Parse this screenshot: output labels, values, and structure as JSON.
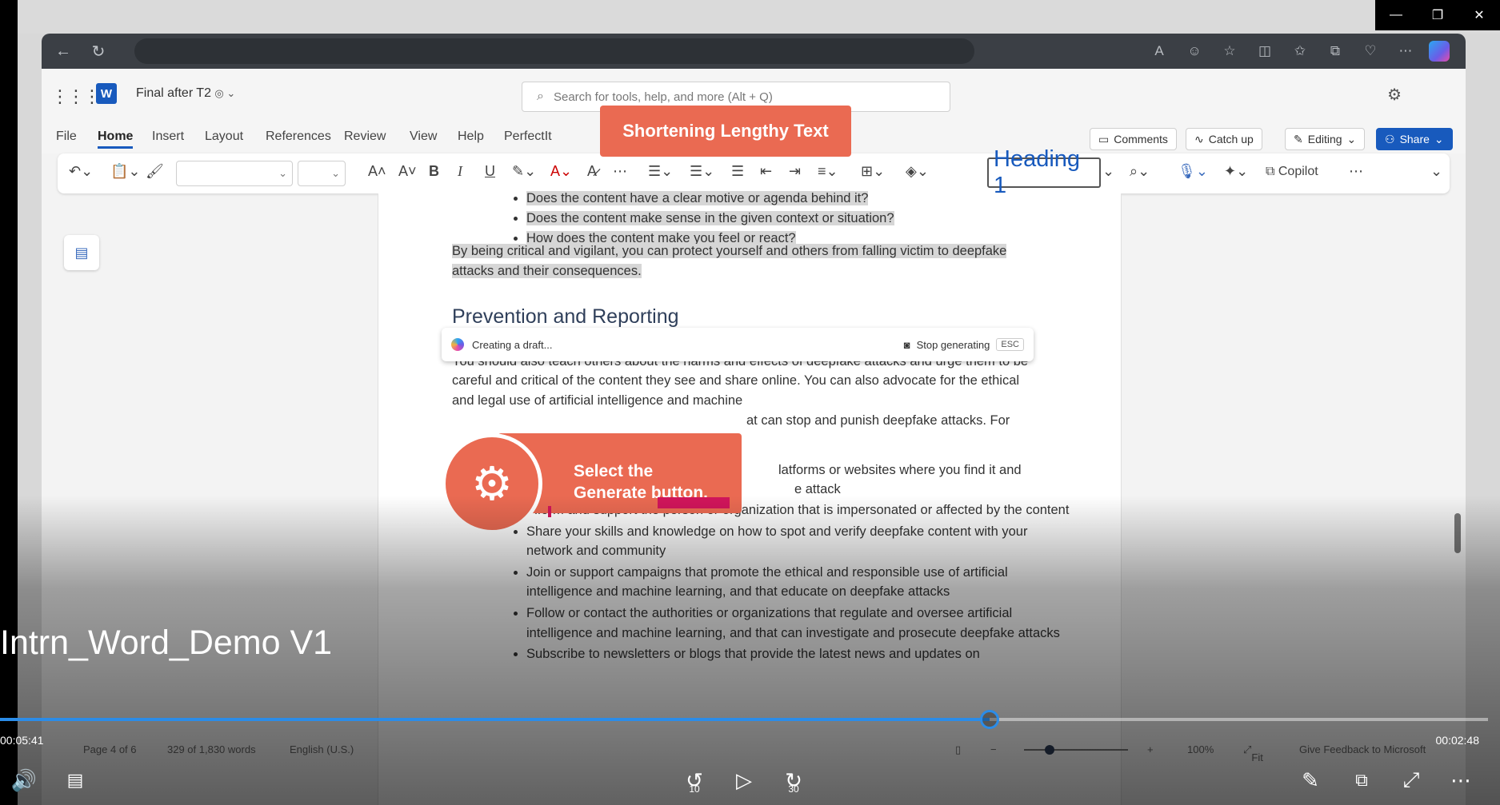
{
  "browser": {
    "icons": [
      "back-icon",
      "refresh-icon",
      "read-aloud-icon",
      "profile-icon",
      "favorite-star-icon",
      "split-screen-icon",
      "favorites-icon",
      "collections-icon",
      "browser-essentials-icon",
      "more-icon",
      "copilot-icon"
    ]
  },
  "word": {
    "app_letter": "W",
    "doc_title": "Final after T2",
    "search_placeholder": "Search for tools, help, and more (Alt + Q)",
    "tabs": [
      "File",
      "Home",
      "Insert",
      "Layout",
      "References",
      "Review",
      "View",
      "Help",
      "PerfectIt"
    ],
    "active_tab": "Home",
    "buttons": {
      "comments": "Comments",
      "catch_up": "Catch up",
      "editing": "Editing",
      "share": "Share"
    },
    "toolbar": {
      "style": "Heading 1",
      "copilot": "Copilot"
    }
  },
  "callouts": {
    "top": "Shortening Lengthy Text",
    "generate_line1": "Select the",
    "generate_line2": "Generate button."
  },
  "document": {
    "bullets_top": [
      "Does the content have a clear motive or agenda behind it?",
      "Does the content make sense in the given context or situation?",
      "How does the content make you feel or react?"
    ],
    "selected_paragraph": "By being critical and vigilant, you can protect yourself and others from falling victim to deepfake attacks and their consequences.",
    "draft_status": "Creating a draft...",
    "stop_label": "Stop generating",
    "esc_label": "ESC",
    "heading": "Prevention and Reporting",
    "body_paragraph": "The third step is to report and flag any harmful or dubious content and avoid sharing or spreading it. You should also teach others about the harms and effects of deepfake attacks and urge them to be careful and critical of the content they see and share online. You can also advocate for the ethical and legal use of artificial intelligence and machine",
    "partial_line": "at can stop and punish deepfake attacks. For",
    "partial_bullet1": "latforms or websites where you find it and",
    "partial_bullet1b": "e attack",
    "bullets_bottom": [
      "Inform and support the person or organization that is impersonated or affected by the content",
      "Share your skills and knowledge on how to spot and verify deepfake content with your network and community",
      "Join or support campaigns that promote the ethical and responsible use of artificial intelligence and machine learning, and that educate on deepfake attacks",
      "Follow or contact the authorities or organizations that regulate and oversee artificial intelligence and machine learning, and that can investigate and prosecute deepfake attacks",
      "Subscribe to newsletters or blogs that provide the latest news and updates on"
    ]
  },
  "statusbar": {
    "page": "Page 4 of 6",
    "words": "329 of 1,830 words",
    "language": "English (U.S.)",
    "zoom": "100%",
    "fit": "Fit",
    "feedback": "Give Feedback to Microsoft"
  },
  "player": {
    "title": "Intrn_Word_Demo V1",
    "elapsed": "00:05:41",
    "remaining": "00:02:48",
    "progress": 0.665,
    "skip_back": "10",
    "skip_forward": "30",
    "accent": "#2b8ce8"
  }
}
